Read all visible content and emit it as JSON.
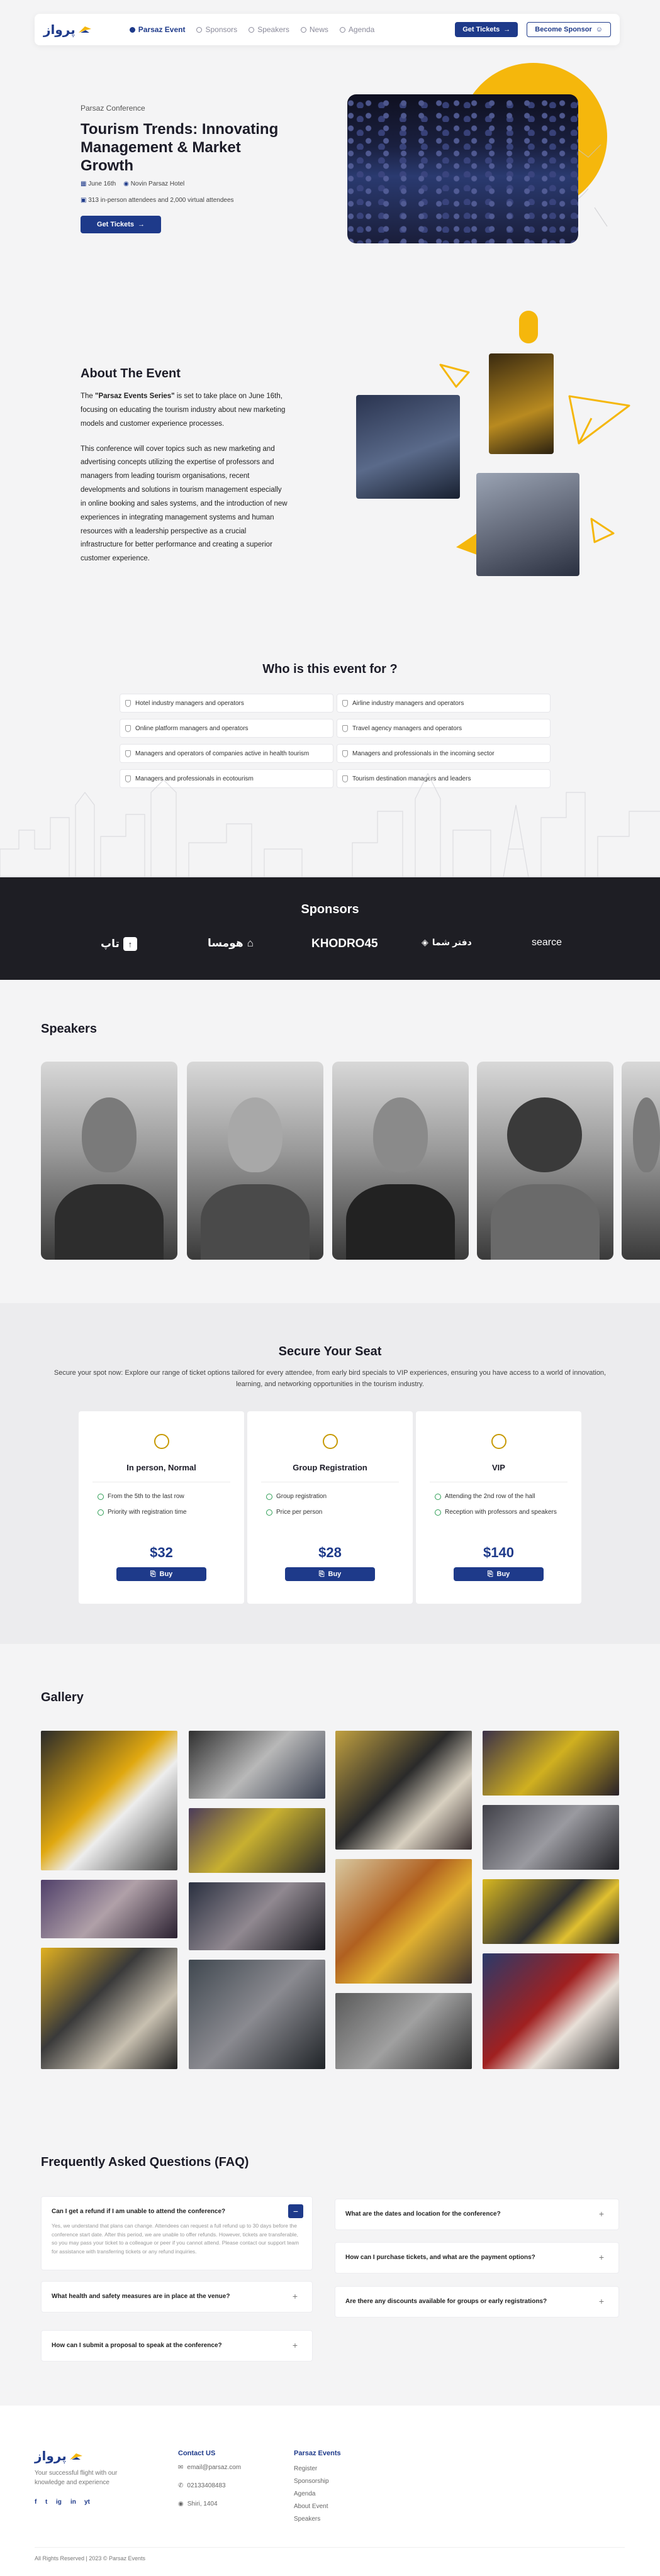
{
  "nav": {
    "logo": "پرواز",
    "links": [
      "Parsaz Event",
      "Sponsors",
      "Speakers",
      "News",
      "Agenda"
    ],
    "get_tickets": "Get Tickets",
    "become_sponsor": "Become Sponsor"
  },
  "hero": {
    "kicker": "Parsaz Conference",
    "title": "Tourism Trends: Innovating Management & Market Growth",
    "date": "June 16th",
    "venue": "Novin Parsaz Hotel",
    "attendance": "313 in-person attendees and 2,000 virtual attendees",
    "cta": "Get Tickets"
  },
  "about": {
    "title": "About The Event",
    "para1_prefix": "The ",
    "para1_bold": "\"Parsaz Events Series\"",
    "para1_rest": " is set to take place on June 16th, focusing on educating the tourism industry about new marketing models and customer experience processes.",
    "para2": "This conference will cover topics such as new marketing and advertising concepts utilizing the expertise of professors and managers from leading tourism organisations, recent developments and solutions in tourism management especially in online booking and sales systems, and the introduction of new experiences in integrating management systems and human resources with a leadership perspective as a crucial infrastructure for better performance and creating a superior customer experience."
  },
  "who": {
    "title": "Who is this event for ?",
    "left": [
      "Hotel industry managers and operators",
      "Online platform managers and operators",
      "Managers and operators of companies active in health tourism",
      "Managers and professionals in ecotourism"
    ],
    "right": [
      "Airline industry managers and operators",
      "Travel agency managers and operators",
      "Managers and professionals in the incoming sector",
      "Tourism destination managers and leaders"
    ]
  },
  "sponsors": {
    "title": "Sponsors",
    "logos": [
      "تاپ",
      "هومسا",
      "KHODRO45",
      "دفتر شما",
      "searce"
    ]
  },
  "speakers": {
    "title": "Speakers",
    "count": 5
  },
  "tickets": {
    "title": "Secure Your Seat",
    "subtitle": "Secure your spot now: Explore our range of ticket options tailored for every attendee, from early bird specials to VIP experiences, ensuring you have access to a world of innovation, learning, and networking opportunities in the tourism industry.",
    "cards": [
      {
        "name": "In person, Normal",
        "features": [
          "From the 5th to the last row",
          "Priority with registration time"
        ],
        "price": "$32",
        "buy": "Buy"
      },
      {
        "name": "Group Registration",
        "features": [
          "Group registration",
          "Price per person"
        ],
        "price": "$28",
        "buy": "Buy"
      },
      {
        "name": "VIP",
        "features": [
          "Attending the 2nd row of the hall",
          "Reception with professors and speakers"
        ],
        "price": "$140",
        "buy": "Buy"
      }
    ]
  },
  "gallery": {
    "title": "Gallery"
  },
  "faq": {
    "title": "Frequently Asked Questions (FAQ)",
    "q1": "Can I get a refund if I am unable to attend the conference?",
    "a1": "Yes, we understand that plans can change. Attendees can request a full refund up to 30 days before the conference start date. After this period, we are unable to offer refunds. However, tickets are transferable, so you may pass your ticket to a colleague or peer if you cannot attend. Please contact our support team for assistance with transferring tickets or any refund inquiries.",
    "q2": "What health and safety measures are in place at the venue?",
    "q3": "How can I submit a proposal to speak at the conference?",
    "q4": "What are the dates and location for the conference?",
    "q5": "How can I purchase tickets, and what are the payment options?",
    "q6": "Are there any discounts available for groups or early registrations?"
  },
  "footer": {
    "logo": "پرواز",
    "description": "Your successful flight with our knowledge and experience",
    "contact_title": "Contact US",
    "email": "email@parsaz.com",
    "phone": "02133408483",
    "address": "Shiri, 1404",
    "events_title": "Parsaz Events",
    "events_links": [
      "Register",
      "Sponsorship",
      "Agenda",
      "About Event",
      "Speakers"
    ],
    "social": [
      "f",
      "t",
      "ig",
      "in",
      "yt"
    ],
    "copyright": "All Rights Reserved | 2023 © Parsaz Events"
  },
  "colors": {
    "primary": "#1e3a8a",
    "accent": "#f5b70c",
    "dark": "#1e1e24"
  }
}
